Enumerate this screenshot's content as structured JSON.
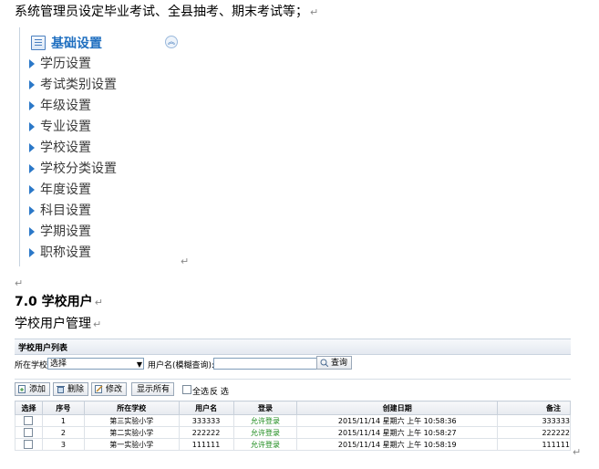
{
  "intro_text": "系统管理员设定毕业考试、全县抽考、期末考试等；",
  "menu": {
    "title": "基础设置",
    "items": [
      {
        "label": "学历设置"
      },
      {
        "label": "考试类别设置"
      },
      {
        "label": "年级设置"
      },
      {
        "label": "专业设置"
      },
      {
        "label": "学校设置"
      },
      {
        "label": "学校分类设置"
      },
      {
        "label": "年度设置"
      },
      {
        "label": "科目设置"
      },
      {
        "label": "学期设置"
      },
      {
        "label": "职称设置"
      }
    ]
  },
  "section_heading": "7.0 学校用户",
  "section_sub": "学校用户管理",
  "paragraph_mark": "↵",
  "grid": {
    "title": "学校用户列表",
    "school_label": "所在学校:",
    "school_value": "选择",
    "username_label": "用户名(模糊查询):",
    "username_value": "",
    "query_button": "查询",
    "add_button": "添加",
    "delete_button": "删除",
    "edit_button": "修改",
    "show_all_button": "显示所有",
    "select_all_label": "全选",
    "invert_label": "反 选",
    "columns": [
      "选择",
      "序号",
      "所在学校",
      "用户名",
      "登录",
      "创建日期",
      "备注"
    ],
    "rows": [
      {
        "no": "1",
        "school": "第三实验小学",
        "user": "333333",
        "login": "允许登录",
        "date": "2015/11/14 星期六 上午 10:58:36",
        "note": "333333"
      },
      {
        "no": "2",
        "school": "第二实验小学",
        "user": "222222",
        "login": "允许登录",
        "date": "2015/11/14 星期六 上午 10:58:27",
        "note": "222222"
      },
      {
        "no": "3",
        "school": "第一实验小学",
        "user": "111111",
        "login": "允许登录",
        "date": "2015/11/14 星期六 上午 10:58:19",
        "note": "111111"
      }
    ]
  },
  "colors": {
    "menu_title": "#1f6fc0",
    "menu_arrow": "#2b78c8",
    "allow_login": "#1a8a1a"
  }
}
